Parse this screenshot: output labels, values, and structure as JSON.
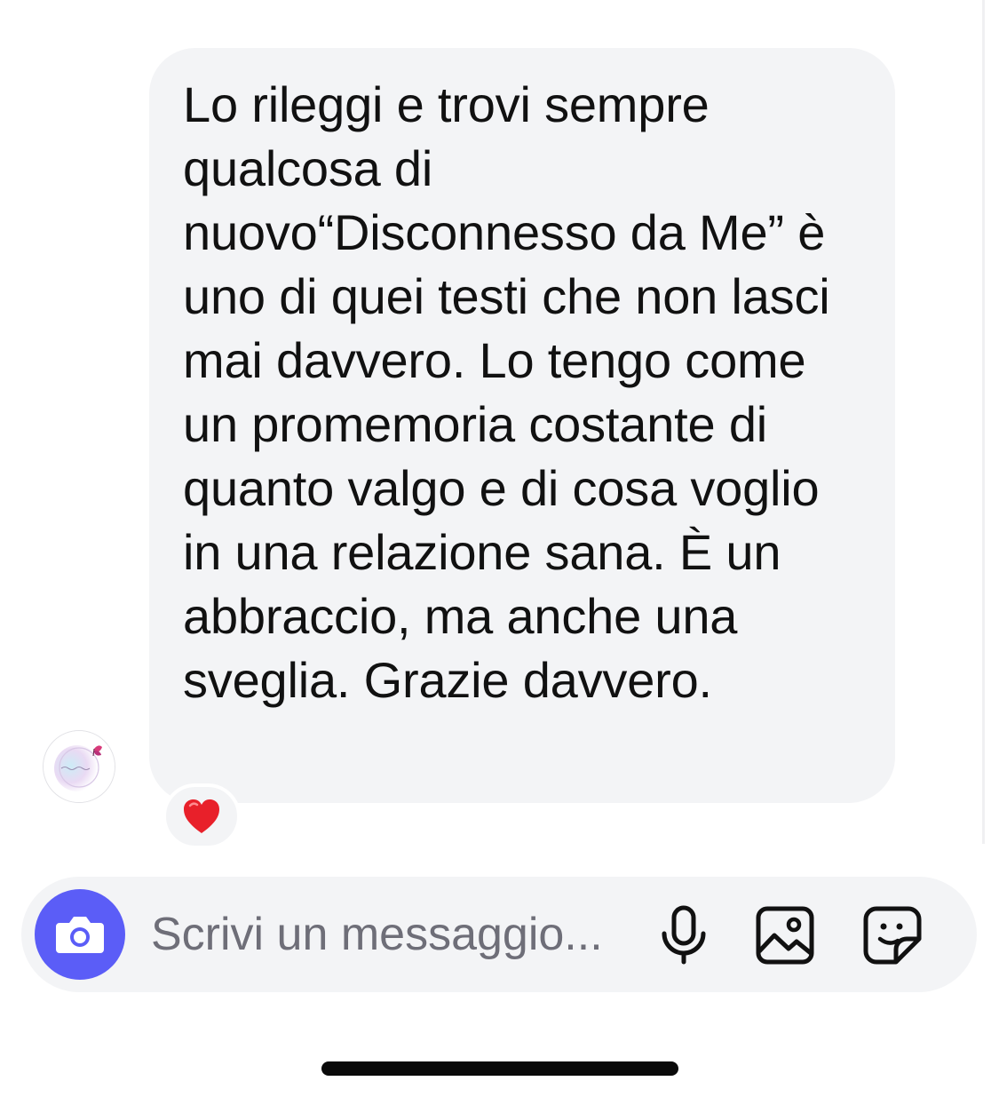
{
  "conversation": {
    "message": {
      "text": "Lo rileggi e trovi sempre qualcosa di nuovo“Disconnesso da Me” è uno di quei testi che non lasci mai davvero. Lo tengo come un promemoria costante di quanto valgo e di cosa voglio in una relazione sana. È un abbraccio, ma anche una sveglia. Grazie davvero.",
      "reaction": "❤️",
      "sender_avatar_icon": "butterfly-logo-avatar"
    }
  },
  "composer": {
    "placeholder": "Scrivi un messaggio...",
    "value": "",
    "icons": {
      "camera": "camera-icon",
      "mic": "microphone-icon",
      "gallery": "image-icon",
      "sticker": "sticker-icon"
    },
    "accent_color": "#5b5df7"
  },
  "colors": {
    "bubble": "#f3f4f6",
    "text": "#111111",
    "placeholder": "#6e6e78"
  }
}
